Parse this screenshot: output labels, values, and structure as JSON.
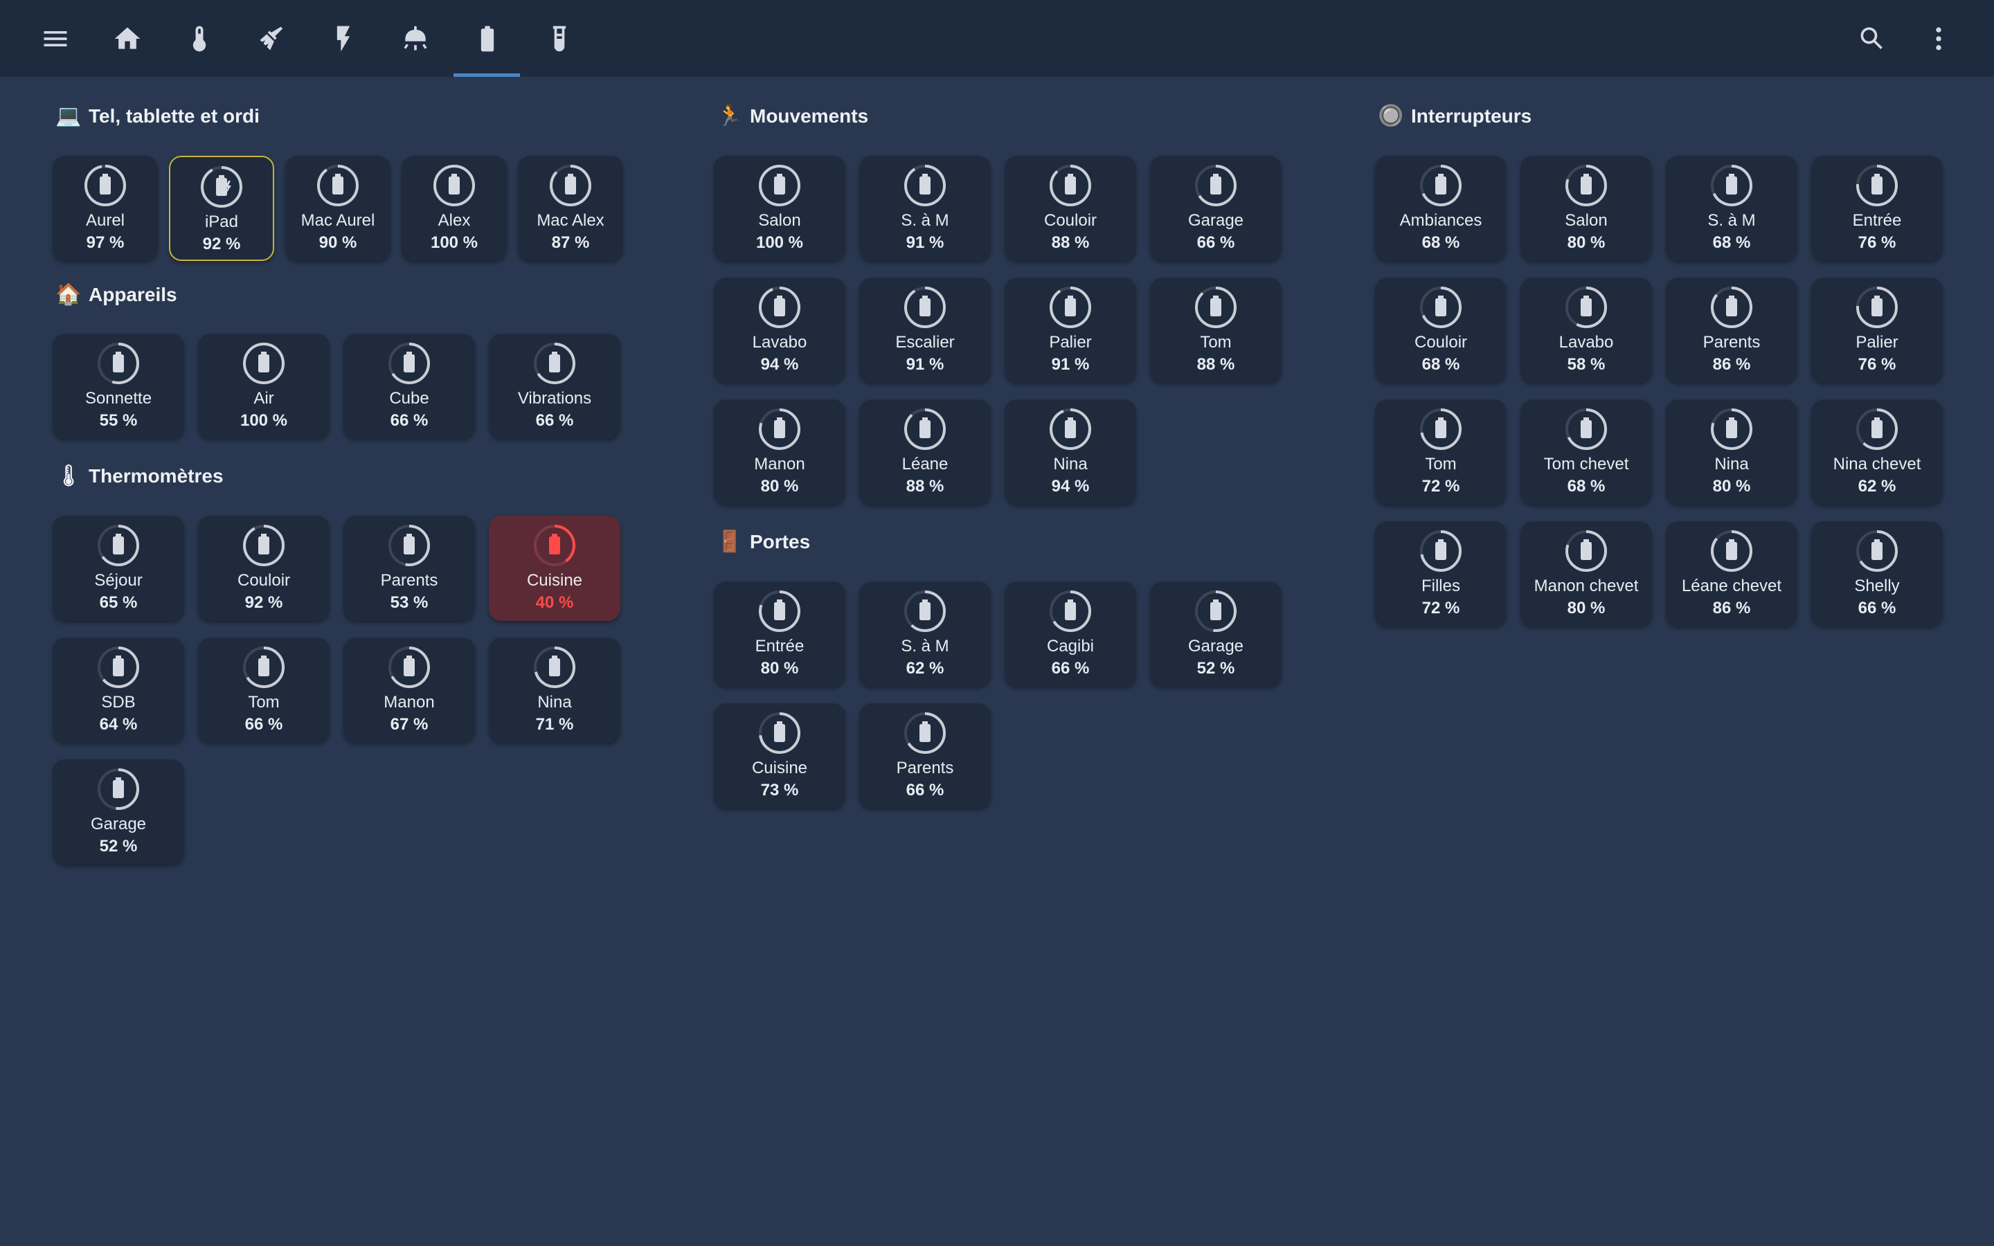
{
  "nav": {
    "menu_icon": "menu-icon",
    "tabs": [
      {
        "icon": "home-icon"
      },
      {
        "icon": "thermometer-icon"
      },
      {
        "icon": "broom-icon"
      },
      {
        "icon": "flash-icon"
      },
      {
        "icon": "ceiling-light-icon"
      },
      {
        "icon": "battery-icon",
        "active": true
      },
      {
        "icon": "test-tube-icon"
      }
    ],
    "search_icon": "search-icon",
    "more_icon": "dots-vertical-icon"
  },
  "colors": {
    "background": "#293850",
    "topbar": "#1e2a3e",
    "card": "#1f2b3d",
    "active_border": "#c9b53a",
    "low_card": "#5b2a34",
    "low_text": "#ff4a4a",
    "tab_indicator": "#4a86c8"
  },
  "sections": [
    {
      "key": "devices",
      "emoji": "💻",
      "title": "Tel, tablette et ordi",
      "cards": [
        {
          "name": "Aurel",
          "pct": "97 %",
          "level": 0.97
        },
        {
          "name": "iPad",
          "pct": "92 %",
          "level": 0.92,
          "charging": true,
          "active": true
        },
        {
          "name": "Mac Aurel",
          "pct": "90 %",
          "level": 0.9
        },
        {
          "name": "Alex",
          "pct": "100 %",
          "level": 1.0
        },
        {
          "name": "Mac Alex",
          "pct": "87 %",
          "level": 0.87
        }
      ]
    },
    {
      "key": "appareils",
      "emoji": "🏠",
      "title": "Appareils",
      "cards": [
        {
          "name": "Sonnette",
          "pct": "55 %",
          "level": 0.55
        },
        {
          "name": "Air",
          "pct": "100 %",
          "level": 1.0
        },
        {
          "name": "Cube",
          "pct": "66 %",
          "level": 0.66
        },
        {
          "name": "Vibrations",
          "pct": "66 %",
          "level": 0.66
        }
      ]
    },
    {
      "key": "thermometres",
      "emoji": "🌡",
      "title": "Thermomètres",
      "cards": [
        {
          "name": "Séjour",
          "pct": "65 %",
          "level": 0.65
        },
        {
          "name": "Couloir",
          "pct": "92 %",
          "level": 0.92
        },
        {
          "name": "Parents",
          "pct": "53 %",
          "level": 0.53
        },
        {
          "name": "Cuisine",
          "pct": "40 %",
          "level": 0.4,
          "low": true
        },
        {
          "name": "SDB",
          "pct": "64 %",
          "level": 0.64
        },
        {
          "name": "Tom",
          "pct": "66 %",
          "level": 0.66
        },
        {
          "name": "Manon",
          "pct": "67 %",
          "level": 0.67
        },
        {
          "name": "Nina",
          "pct": "71 %",
          "level": 0.71
        },
        {
          "name": "Garage",
          "pct": "52 %",
          "level": 0.52
        }
      ]
    },
    {
      "key": "mouvements",
      "emoji": "🏃",
      "title": "Mouvements",
      "cards": [
        {
          "name": "Salon",
          "pct": "100 %",
          "level": 1.0
        },
        {
          "name": "S. à M",
          "pct": "91 %",
          "level": 0.91
        },
        {
          "name": "Couloir",
          "pct": "88 %",
          "level": 0.88
        },
        {
          "name": "Garage",
          "pct": "66 %",
          "level": 0.66
        },
        {
          "name": "Lavabo",
          "pct": "94 %",
          "level": 0.94
        },
        {
          "name": "Escalier",
          "pct": "91 %",
          "level": 0.91
        },
        {
          "name": "Palier",
          "pct": "91 %",
          "level": 0.91
        },
        {
          "name": "Tom",
          "pct": "88 %",
          "level": 0.88
        },
        {
          "name": "Manon",
          "pct": "80 %",
          "level": 0.8
        },
        {
          "name": "Léane",
          "pct": "88 %",
          "level": 0.88
        },
        {
          "name": "Nina",
          "pct": "94 %",
          "level": 0.94
        }
      ]
    },
    {
      "key": "portes",
      "emoji": "🚪",
      "title": "Portes",
      "cards": [
        {
          "name": "Entrée",
          "pct": "80 %",
          "level": 0.8
        },
        {
          "name": "S. à M",
          "pct": "62 %",
          "level": 0.62
        },
        {
          "name": "Cagibi",
          "pct": "66 %",
          "level": 0.66
        },
        {
          "name": "Garage",
          "pct": "52 %",
          "level": 0.52
        },
        {
          "name": "Cuisine",
          "pct": "73 %",
          "level": 0.73
        },
        {
          "name": "Parents",
          "pct": "66 %",
          "level": 0.66
        }
      ]
    },
    {
      "key": "interrupteurs",
      "emoji": "🔘",
      "title": "Interrupteurs",
      "cards": [
        {
          "name": "Ambiances",
          "pct": "68 %",
          "level": 0.68
        },
        {
          "name": "Salon",
          "pct": "80 %",
          "level": 0.8
        },
        {
          "name": "S. à M",
          "pct": "68 %",
          "level": 0.68
        },
        {
          "name": "Entrée",
          "pct": "76 %",
          "level": 0.76
        },
        {
          "name": "Couloir",
          "pct": "68 %",
          "level": 0.68
        },
        {
          "name": "Lavabo",
          "pct": "58 %",
          "level": 0.58
        },
        {
          "name": "Parents",
          "pct": "86 %",
          "level": 0.86
        },
        {
          "name": "Palier",
          "pct": "76 %",
          "level": 0.76
        },
        {
          "name": "Tom",
          "pct": "72 %",
          "level": 0.72
        },
        {
          "name": "Tom chevet",
          "pct": "68 %",
          "level": 0.68
        },
        {
          "name": "Nina",
          "pct": "80 %",
          "level": 0.8
        },
        {
          "name": "Nina chevet",
          "pct": "62 %",
          "level": 0.62
        },
        {
          "name": "Filles",
          "pct": "72 %",
          "level": 0.72
        },
        {
          "name": "Manon chevet",
          "pct": "80 %",
          "level": 0.8
        },
        {
          "name": "Léane chevet",
          "pct": "86 %",
          "level": 0.86
        },
        {
          "name": "Shelly",
          "pct": "66 %",
          "level": 0.66
        }
      ]
    }
  ]
}
